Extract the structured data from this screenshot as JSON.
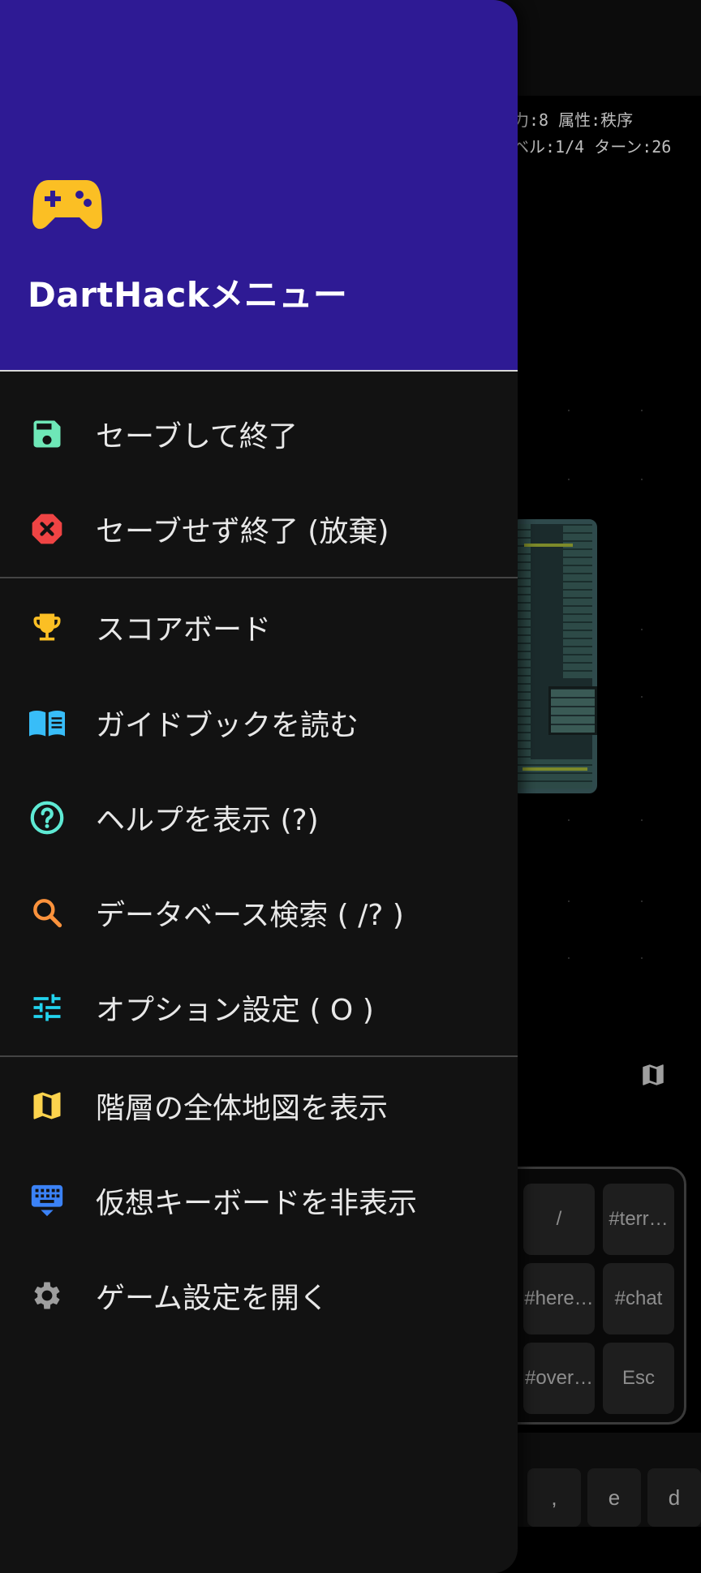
{
  "background_game": {
    "status_line_1": "力:8 属性:秩序",
    "status_line_2": "ベル:1/4 ターン:26",
    "keyboard_keys": [
      "/",
      "#terr…",
      "#here…",
      "#chat",
      "#over…",
      "Esc"
    ],
    "bottom_keys": [
      ",",
      "e",
      "d"
    ]
  },
  "drawer": {
    "title": "DartHackメニュー",
    "header_icon": "gamepad-icon",
    "sections": [
      {
        "items": [
          {
            "label": "セーブして終了",
            "icon": "save-icon",
            "color": "#6ee7b7"
          },
          {
            "label": "セーブせず終了 (放棄)",
            "icon": "cancel-icon",
            "color": "#ef4444"
          }
        ]
      },
      {
        "items": [
          {
            "label": "スコアボード",
            "icon": "trophy-icon",
            "color": "#fbbf24"
          },
          {
            "label": "ガイドブックを読む",
            "icon": "book-icon",
            "color": "#38bdf8"
          },
          {
            "label": "ヘルプを表示 (?)",
            "icon": "help-icon",
            "color": "#5eead4"
          },
          {
            "label": "データベース検索 ( /? )",
            "icon": "search-icon",
            "color": "#fb923c"
          },
          {
            "label": "オプション設定 ( O )",
            "icon": "tune-icon",
            "color": "#22d3ee"
          }
        ]
      },
      {
        "items": [
          {
            "label": "階層の全体地図を表示",
            "icon": "map-icon",
            "color": "#fcd34d"
          },
          {
            "label": "仮想キーボードを非表示",
            "icon": "keyboard-hide-icon",
            "color": "#3b82f6"
          },
          {
            "label": "ゲーム設定を開く",
            "icon": "gear-icon",
            "color": "#9e9e9e"
          }
        ]
      }
    ]
  },
  "colors": {
    "header_bg": "#2e1a94",
    "drawer_bg": "#121212",
    "gamepad": "#fbbf24"
  }
}
